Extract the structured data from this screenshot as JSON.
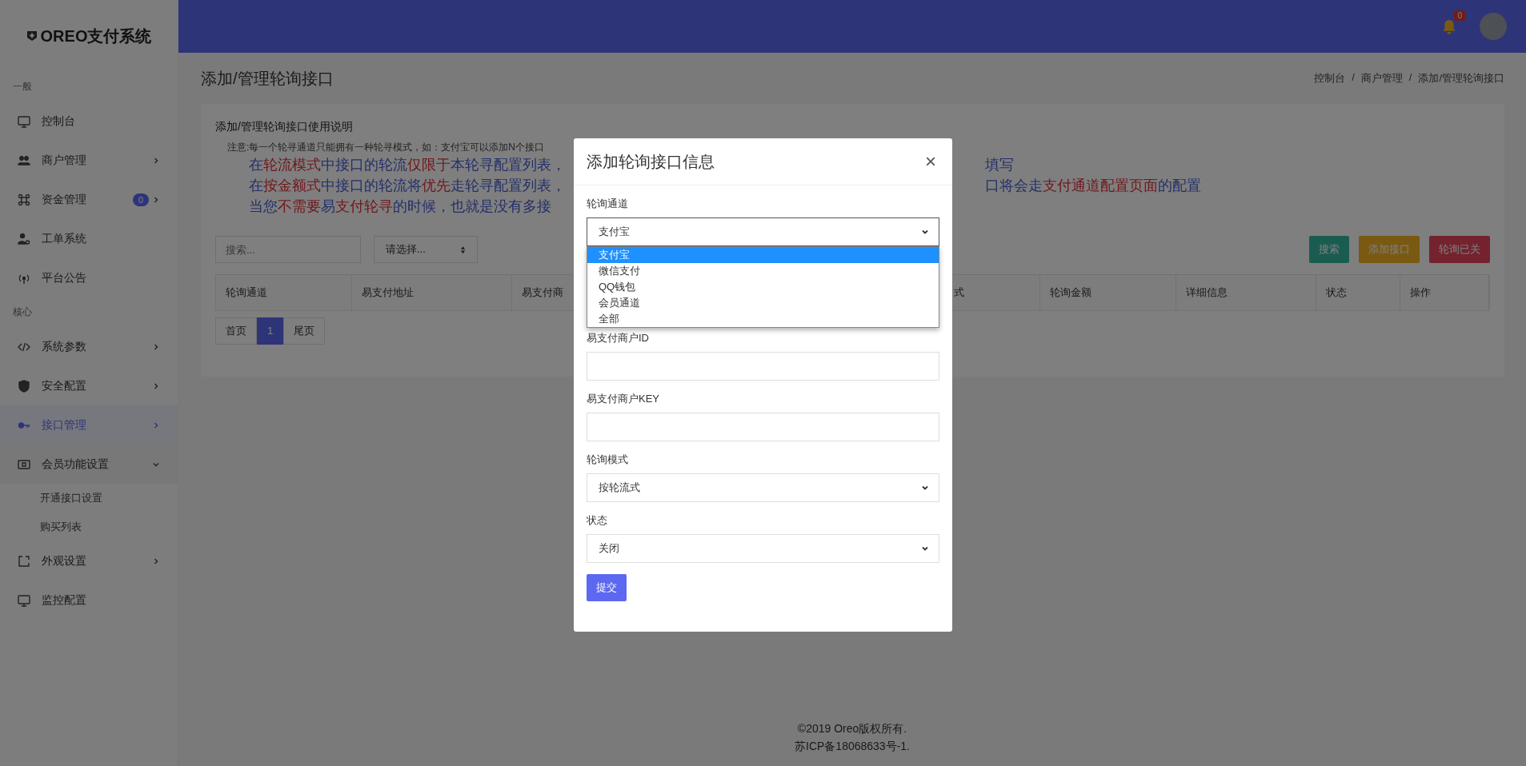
{
  "sidebar": {
    "brand": "OREO支付系统",
    "sections": [
      {
        "heading": "一般",
        "items": [
          {
            "label": "控制台",
            "selected": false
          },
          {
            "label": "商户管理",
            "selected": false,
            "expanded": false
          },
          {
            "label": "资金管理",
            "selected": false,
            "expanded": false,
            "badge": "0"
          },
          {
            "label": "工单系统",
            "selected": false
          },
          {
            "label": "平台公告",
            "selected": false
          }
        ]
      },
      {
        "heading": "核心",
        "items": [
          {
            "label": "系统参数",
            "selected": false,
            "expanded": false
          },
          {
            "label": "安全配置",
            "selected": false,
            "expanded": false
          },
          {
            "label": "接口管理",
            "selected": true,
            "expanded": false
          },
          {
            "label": "会员功能设置",
            "selected": false,
            "expanded": true,
            "children": [
              {
                "label": "开通接口设置",
                "selected": false
              },
              {
                "label": "购买列表",
                "selected": false
              }
            ]
          },
          {
            "label": "外观设置",
            "selected": false,
            "expanded": false
          },
          {
            "label": "监控配置",
            "selected": false
          }
        ]
      }
    ]
  },
  "header": {
    "notification_count": "0"
  },
  "page": {
    "title": "添加/管理轮询接口",
    "breadcrumbs": [
      "控制台",
      "商户管理",
      "添加/管理轮询接口"
    ],
    "breadcrumb_separator": "/"
  },
  "instructions": {
    "title": "添加/管理轮询接口使用说明",
    "note": "注意:每一个轮寻通道只能拥有一种轮寻模式，如：支付宝可以添加N个接口",
    "lines": [
      {
        "left": [
          {
            "text": "在",
            "emphasis": false
          },
          {
            "text": "轮流模式",
            "emphasis": true
          },
          {
            "text": "中接口的轮流",
            "emphasis": false
          },
          {
            "text": "仅限于",
            "emphasis": true
          },
          {
            "text": "本轮寻配置列表，",
            "emphasis": false
          }
        ],
        "right": [
          {
            "text": "填写",
            "emphasis": false
          }
        ]
      },
      {
        "left": [
          {
            "text": "在",
            "emphasis": false
          },
          {
            "text": "按金额式",
            "emphasis": true
          },
          {
            "text": "中接口的轮流将",
            "emphasis": false
          },
          {
            "text": "优先",
            "emphasis": true
          },
          {
            "text": "走轮寻配置列表，",
            "emphasis": false
          }
        ],
        "right": [
          {
            "text": "口将会走",
            "emphasis": false
          },
          {
            "text": "支付通道配置页面",
            "emphasis": true
          },
          {
            "text": "的配置",
            "emphasis": false
          }
        ]
      },
      {
        "left": [
          {
            "text": "当您",
            "emphasis": false
          },
          {
            "text": "不需要",
            "emphasis": true
          },
          {
            "text": "易",
            "emphasis": false
          },
          {
            "text": "支付轮寻",
            "emphasis": true
          },
          {
            "text": "的时候，也就是没有多接",
            "emphasis": false
          }
        ]
      }
    ]
  },
  "toolbar": {
    "search_placeholder": "搜索...",
    "filter": "请选择...",
    "buttons": [
      {
        "label": "搜索",
        "kind": "search"
      },
      {
        "label": "添加接口",
        "kind": "add"
      },
      {
        "label": "轮询已关",
        "kind": "toggle"
      }
    ]
  },
  "table": {
    "columns": [
      "轮询通道",
      "易支付地址",
      "易支付商",
      "式",
      "轮询金额",
      "详细信息",
      "状态",
      "操作"
    ]
  },
  "pagination": [
    {
      "label": "首页",
      "selected": false
    },
    {
      "label": "1",
      "selected": true
    },
    {
      "label": "尾页",
      "selected": false
    }
  ],
  "footer": {
    "copyright": "©2019 Oreo版权所有.",
    "icp": "苏ICP备18068633号-1."
  },
  "modal": {
    "title": "添加轮询接口信息",
    "close": "×",
    "fields": [
      {
        "kind": "select",
        "label": "轮询通道",
        "value": "支付宝",
        "open": true,
        "options": [
          {
            "label": "支付宝",
            "selected": true
          },
          {
            "label": "微信支付",
            "selected": false
          },
          {
            "label": "QQ钱包",
            "selected": false
          },
          {
            "label": "会员通道",
            "selected": false
          },
          {
            "label": "全部",
            "selected": false
          }
        ]
      },
      {
        "kind": "input",
        "label": "易支付商户ID"
      },
      {
        "kind": "input",
        "label": "易支付商户KEY"
      },
      {
        "kind": "select",
        "label": "轮询模式",
        "value": "按轮流式",
        "open": false
      },
      {
        "kind": "select",
        "label": "状态",
        "value": "关闭",
        "open": false
      }
    ],
    "submit": "提交"
  }
}
